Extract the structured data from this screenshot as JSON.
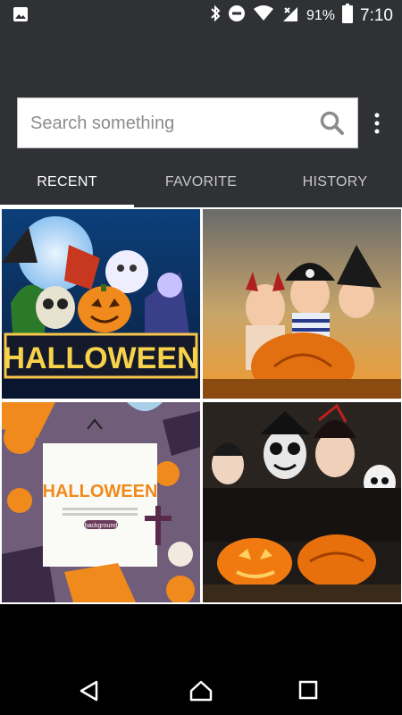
{
  "status_bar": {
    "battery": "91%",
    "time": "7:10",
    "icons": [
      "gallery-icon",
      "bluetooth-icon",
      "dnd-icon",
      "wifi-icon",
      "cell-signal-icon",
      "battery-icon"
    ]
  },
  "search": {
    "placeholder": "Search something",
    "value": ""
  },
  "tabs": [
    {
      "label": "RECENT",
      "active": true
    },
    {
      "label": "FAVORITE",
      "active": false
    },
    {
      "label": "HISTORY",
      "active": false
    }
  ],
  "images": [
    {
      "name": "halloween-poster",
      "banner_text": "HALLOWEEN"
    },
    {
      "name": "kids-pumpkin-photo"
    },
    {
      "name": "halloween-card",
      "card_title": "HALLOWEEN",
      "card_button": "background"
    },
    {
      "name": "family-halloween-photo"
    }
  ],
  "nav_icons": [
    "back-icon",
    "home-icon",
    "recents-icon"
  ],
  "colors": {
    "header_bg": "#2f3134",
    "tab_active": "#ffffff",
    "tab_inactive": "#c8c8c8",
    "orange": "#f08a1c"
  }
}
